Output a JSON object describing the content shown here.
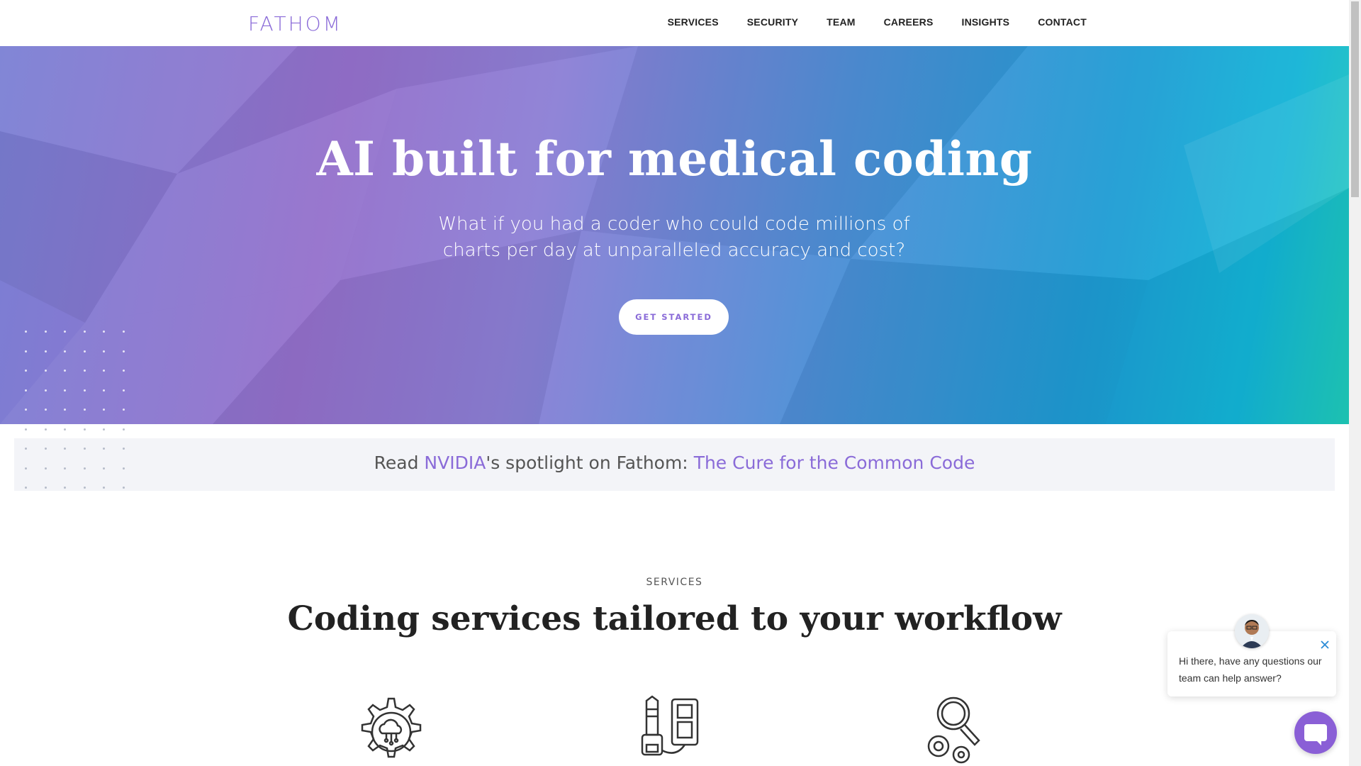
{
  "header": {
    "logo": "FATHOM",
    "nav": [
      {
        "label": "SERVICES"
      },
      {
        "label": "SECURITY"
      },
      {
        "label": "TEAM"
      },
      {
        "label": "CAREERS"
      },
      {
        "label": "INSIGHTS"
      },
      {
        "label": "CONTACT"
      }
    ]
  },
  "hero": {
    "title": "AI built for medical coding",
    "subtitle": "What if you had a coder who could code millions of charts per day at unparalleled accuracy and cost?",
    "cta_label": "GET STARTED"
  },
  "banner": {
    "prefix": "Read ",
    "nvidia_link": "NVIDIA",
    "middle": "'s spotlight on Fathom: ",
    "article_link": "The Cure for the Common Code"
  },
  "services": {
    "kicker": "SERVICES",
    "title": "Coding services tailored to your workflow",
    "icons": [
      "gear-cloud-icon",
      "key-lock-icon",
      "magnifier-gears-icon"
    ]
  },
  "chat": {
    "message": "Hi there, have any questions our team can help answer?"
  },
  "colors": {
    "accent": "#8a6bd8",
    "banner_bg": "#f3f4f8",
    "chat_launcher": "#8a5fd6"
  }
}
